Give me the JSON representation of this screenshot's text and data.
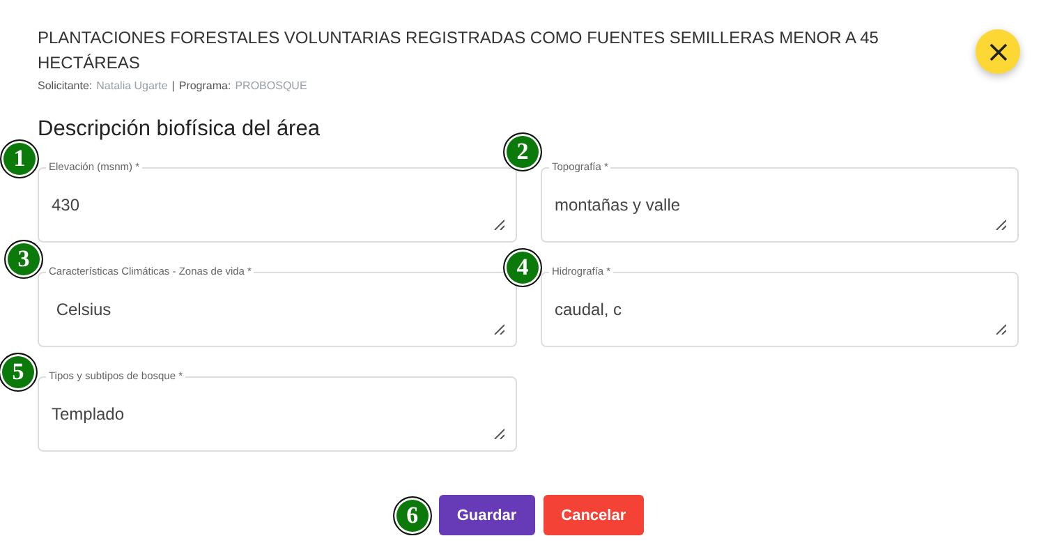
{
  "header": {
    "title": "PLANTACIONES FORESTALES VOLUNTARIAS REGISTRADAS COMO FUENTES SEMILLERAS MENOR A 45 HECTÁREAS",
    "applicant_label": "Solicitante:",
    "applicant": "Natalia Ugarte",
    "separator": "|",
    "program_label": "Programa:",
    "program": "PROBOSQUE"
  },
  "section_title": "Descripción biofísica del área",
  "fields": [
    {
      "label": "Elevación (msnm) *",
      "value": "430",
      "badge": "1"
    },
    {
      "label": "Topografía *",
      "value": "montañas y valle",
      "badge": "2"
    },
    {
      "label": "Características Climáticas - Zonas de vida *",
      "value": " Celsius",
      "badge": "3"
    },
    {
      "label": "Hidrografía *",
      "value": "caudal, c",
      "badge": "4"
    },
    {
      "label": "Tipos y subtipos de bosque *",
      "value": "Templado",
      "badge": "5"
    }
  ],
  "actions": {
    "badge": "6",
    "buttons": [
      {
        "label": "Guardar",
        "kind": "primary"
      },
      {
        "label": "Cancelar",
        "kind": "danger"
      }
    ]
  }
}
